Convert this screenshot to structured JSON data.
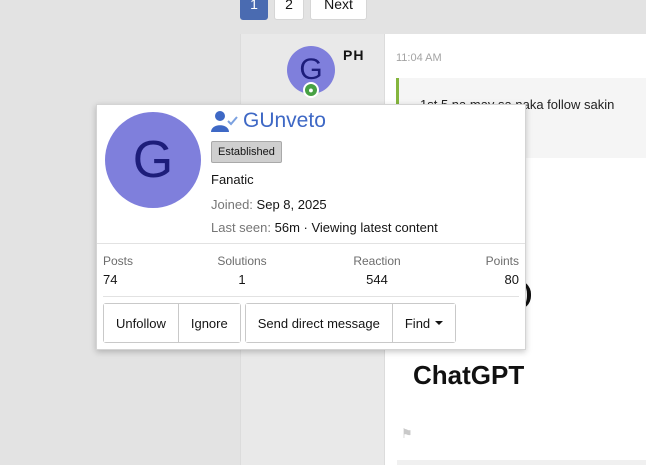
{
  "pagination": {
    "current": "1",
    "page2": "2",
    "next_label": "Next"
  },
  "post": {
    "avatar_letter": "G",
    "username": "PH",
    "time": "11:04 AM",
    "quote_text": "1st 5 na may sa naka follow sakin",
    "heading": "ChatGPT"
  },
  "card": {
    "avatar_letter": "G",
    "username": "GUnveto",
    "badge": "Established",
    "user_title": "Fanatic",
    "joined_label": "Joined:",
    "joined_value": "Sep 8, 2025",
    "lastseen_label": "Last seen:",
    "lastseen_value": "56m · Viewing latest content",
    "stats": [
      {
        "label": "Posts",
        "value": "74"
      },
      {
        "label": "Solutions",
        "value": "1"
      },
      {
        "label": "Reaction",
        "value": "544"
      },
      {
        "label": "Points",
        "value": "80"
      }
    ],
    "actions": {
      "unfollow": "Unfollow",
      "ignore": "Ignore",
      "send_message": "Send direct message",
      "find": "Find"
    }
  },
  "icons": {
    "user_check": "user-check-icon",
    "online": "online-status-icon",
    "flag": "report-flag-icon",
    "caret": "caret-down-icon"
  },
  "colors": {
    "accent": "#3e68c5",
    "avatar_bg": "#7f7fdc",
    "online": "#47a144",
    "quote_bar": "#84b53d"
  }
}
